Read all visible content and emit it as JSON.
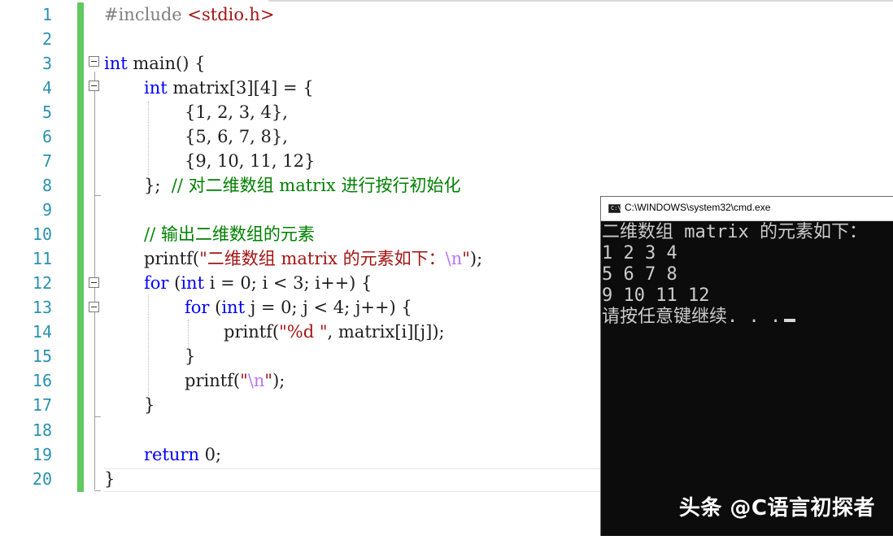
{
  "editor": {
    "line_numbers": [
      "1",
      "2",
      "3",
      "4",
      "5",
      "6",
      "7",
      "8",
      "9",
      "10",
      "11",
      "12",
      "13",
      "14",
      "15",
      "16",
      "17",
      "18",
      "19",
      "20"
    ],
    "lines": {
      "l1": {
        "pp": "#include ",
        "inc": "<stdio.h>"
      },
      "l3": {
        "kw": "int",
        "rest": " main() {"
      },
      "l4": {
        "kw": "int",
        "rest": " matrix[3][4] = {"
      },
      "l5": {
        "text": "{1, 2, 3, 4},"
      },
      "l6": {
        "text": "{5, 6, 7, 8},"
      },
      "l7": {
        "text": "{9, 10, 11, 12}"
      },
      "l8": {
        "text": "};  ",
        "comment": "// 对二维数组 matrix 进行按行初始化"
      },
      "l10": {
        "comment": "// 输出二维数组的元素"
      },
      "l11": {
        "fn": "printf(",
        "str": "\"二维数组 matrix 的元素如下：",
        "esc": "\\n",
        "strend": "\"",
        "end": ");"
      },
      "l12": {
        "kw": "for",
        "a": " (",
        "kw2": "int",
        "b": " i = 0; i < 3; i++) {"
      },
      "l13": {
        "kw": "for",
        "a": " (",
        "kw2": "int",
        "b": " j = 0; j < 4; j++) {"
      },
      "l14": {
        "fn": "printf(",
        "str": "\"%d \"",
        "end": ", matrix[i][j]);"
      },
      "l15": {
        "text": "}"
      },
      "l16": {
        "fn": "printf(",
        "str": "\"",
        "esc": "\\n",
        "strend": "\"",
        "end": ");"
      },
      "l17": {
        "text": "}"
      },
      "l19": {
        "kw": "return",
        "rest": " 0;"
      },
      "l20": {
        "text": "}"
      }
    }
  },
  "console": {
    "title": "C:\\WINDOWS\\system32\\cmd.exe",
    "icon": "cmd-icon",
    "output": [
      "二维数组 matrix 的元素如下：",
      "1 2 3 4",
      "5 6 7 8",
      "9 10 11 12",
      "请按任意键继续. . ."
    ]
  },
  "watermark": "头条 @C语言初探者",
  "colors": {
    "line_number": "#2b91af",
    "keyword": "#0000ff",
    "string": "#a31515",
    "comment": "#008000",
    "escape": "#b776fb",
    "change_bar": "#60c960",
    "console_bg": "#0c0c0c",
    "console_text": "#cccccc"
  }
}
